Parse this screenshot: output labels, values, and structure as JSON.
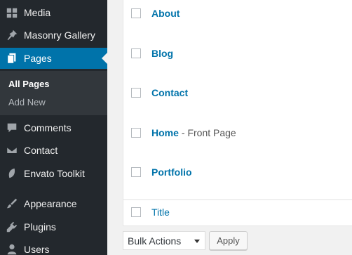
{
  "sidebar": {
    "items": [
      {
        "label": "Media",
        "icon": "media-icon"
      },
      {
        "label": "Masonry Gallery",
        "icon": "pin-icon"
      },
      {
        "label": "Pages",
        "icon": "pages-icon"
      },
      {
        "label": "Comments",
        "icon": "comment-icon"
      },
      {
        "label": "Contact",
        "icon": "envelope-icon"
      },
      {
        "label": "Envato Toolkit",
        "icon": "leaf-icon"
      },
      {
        "label": "Appearance",
        "icon": "brush-icon"
      },
      {
        "label": "Plugins",
        "icon": "plug-icon"
      },
      {
        "label": "Users",
        "icon": "user-icon"
      }
    ],
    "submenu": [
      {
        "label": "All Pages"
      },
      {
        "label": "Add New"
      }
    ]
  },
  "pages": [
    {
      "title": "About"
    },
    {
      "title": "Blog"
    },
    {
      "title": "Contact"
    },
    {
      "title": "Home",
      "suffix": "- Front Page"
    },
    {
      "title": "Portfolio"
    }
  ],
  "footer_column": {
    "label": "Title"
  },
  "bulk": {
    "selected": "Bulk Actions",
    "apply_label": "Apply"
  },
  "colors": {
    "sidebar_bg": "#23282d",
    "accent": "#0073aa",
    "submenu_bg": "#32373c"
  }
}
